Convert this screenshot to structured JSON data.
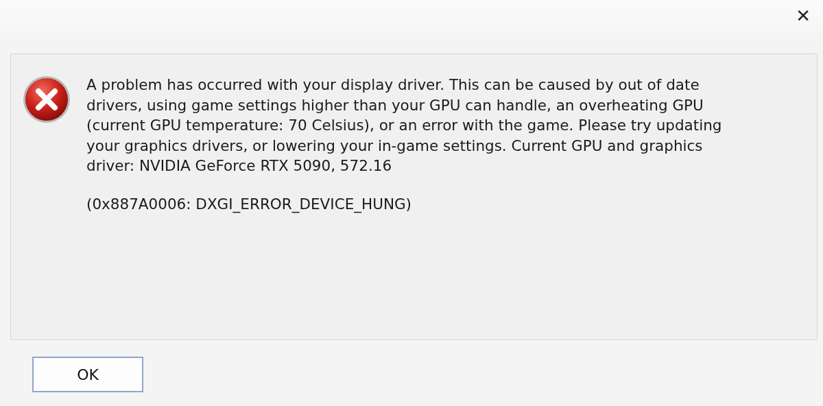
{
  "window": {
    "close": "✕"
  },
  "message": {
    "text": "A problem has occurred with your display driver. This can be caused by out of date drivers, using game settings higher than your GPU can handle, an overheating GPU (current GPU temperature: 70 Celsius), or an error with the game. Please try updating your graphics drivers, or lowering your in-game settings. Current GPU and graphics driver: NVIDIA GeForce RTX 5090, 572.16",
    "code": "(0x887A0006: DXGI_ERROR_DEVICE_HUNG)"
  },
  "buttons": [
    {
      "label": "OK",
      "selected": true
    }
  ]
}
